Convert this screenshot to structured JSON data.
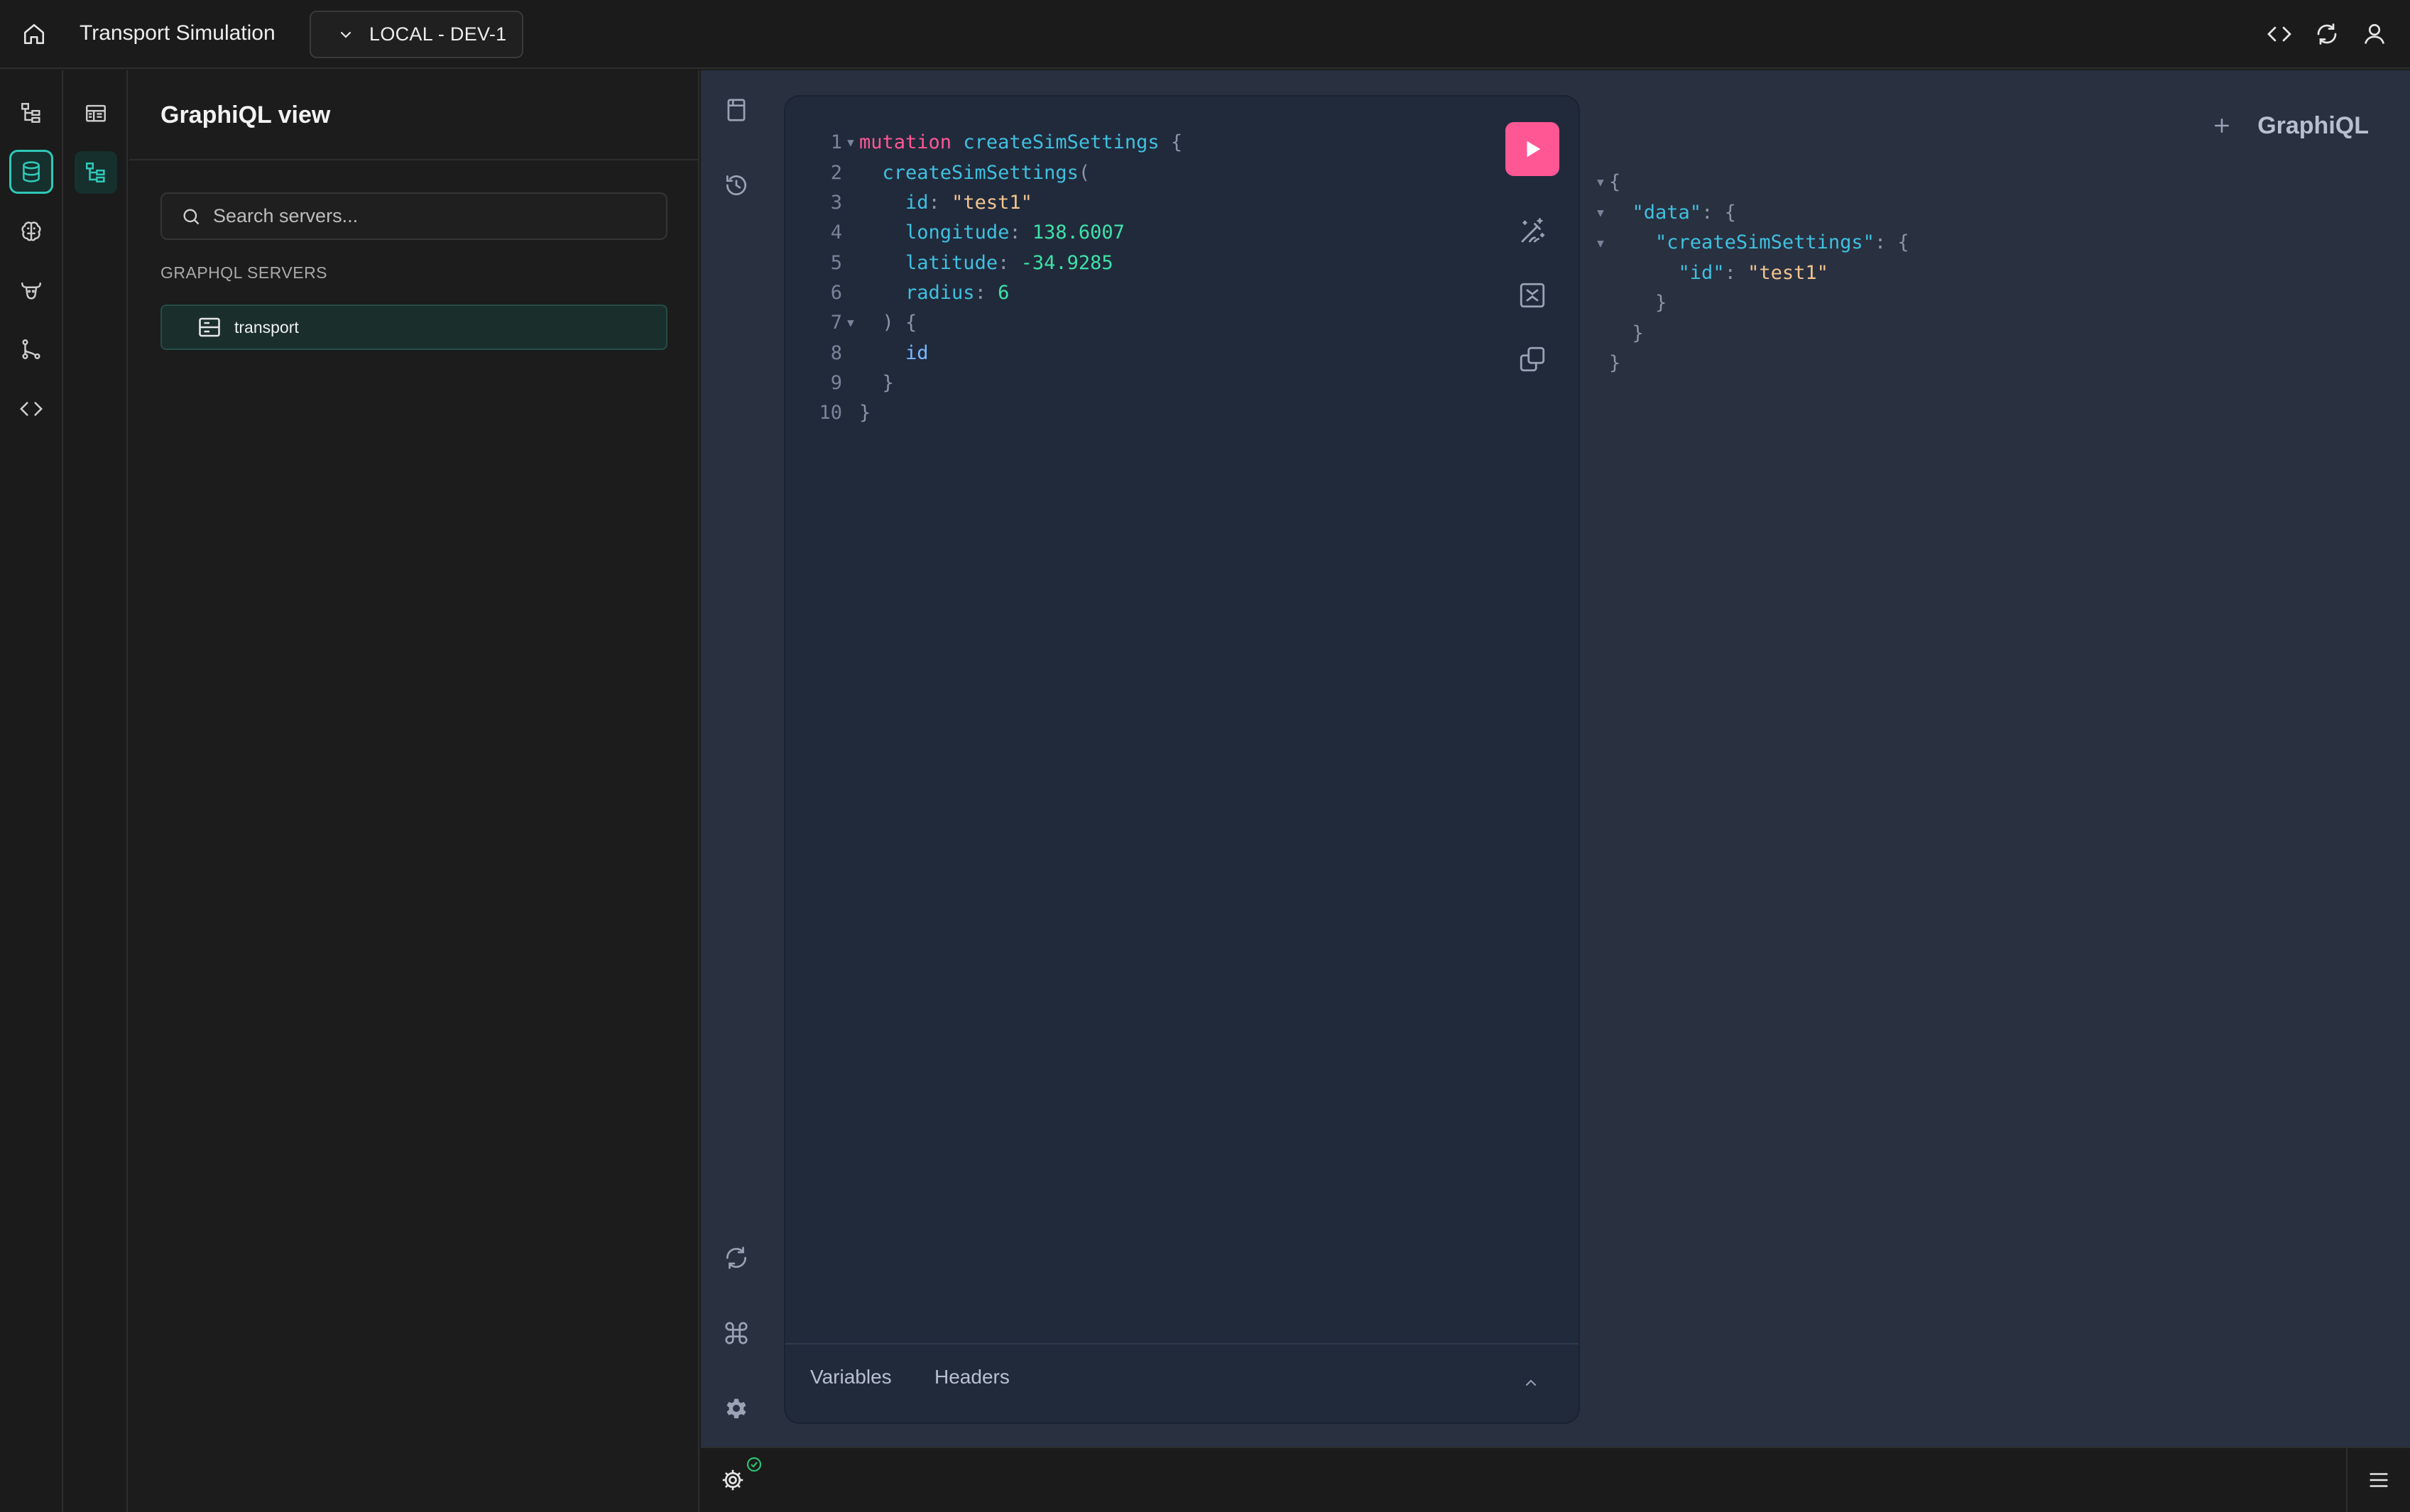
{
  "topbar": {
    "app_title": "Transport Simulation",
    "environment": "LOCAL - DEV-1",
    "icons": [
      "home-icon",
      "chevron-down-icon",
      "code-icon",
      "refresh-icon",
      "user-icon"
    ]
  },
  "rail": {
    "items": [
      {
        "name": "tree-icon",
        "active": false
      },
      {
        "name": "database-icon",
        "active": true
      },
      {
        "name": "brain-icon",
        "active": false
      },
      {
        "name": "bull-icon",
        "active": false
      },
      {
        "name": "git-branch-icon",
        "active": false
      },
      {
        "name": "code-icon",
        "active": false
      }
    ]
  },
  "subrail": {
    "items": [
      {
        "name": "dashboard-icon",
        "active": false
      },
      {
        "name": "tree-icon",
        "active": true
      }
    ]
  },
  "panel": {
    "title": "GraphiQL view",
    "search_placeholder": "Search servers...",
    "section_label": "GRAPHQL SERVERS",
    "servers": [
      {
        "label": "transport"
      }
    ]
  },
  "graphiql": {
    "header_title": "GraphiQL",
    "query_lines": [
      {
        "n": "1",
        "fold": true
      },
      {
        "n": "2",
        "fold": false
      },
      {
        "n": "3",
        "fold": false
      },
      {
        "n": "4",
        "fold": false
      },
      {
        "n": "5",
        "fold": false
      },
      {
        "n": "6",
        "fold": false
      },
      {
        "n": "7",
        "fold": true
      },
      {
        "n": "8",
        "fold": false
      },
      {
        "n": "9",
        "fold": false
      },
      {
        "n": "10",
        "fold": false
      }
    ],
    "query": {
      "keyword": "mutation",
      "operation_name": "createSimSettings",
      "field_name": "createSimSettings",
      "args": [
        {
          "name": "id",
          "value": "\"test1\""
        },
        {
          "name": "longitude",
          "value": "138.6007"
        },
        {
          "name": "latitude",
          "value": "-34.9285"
        },
        {
          "name": "radius",
          "value": "6"
        }
      ],
      "selection": "id"
    },
    "response": {
      "key_data": "\"data\"",
      "key_op": "\"createSimSettings\"",
      "key_id": "\"id\"",
      "value_id": "\"test1\""
    },
    "tabs": {
      "variables": "Variables",
      "headers": "Headers"
    }
  }
}
